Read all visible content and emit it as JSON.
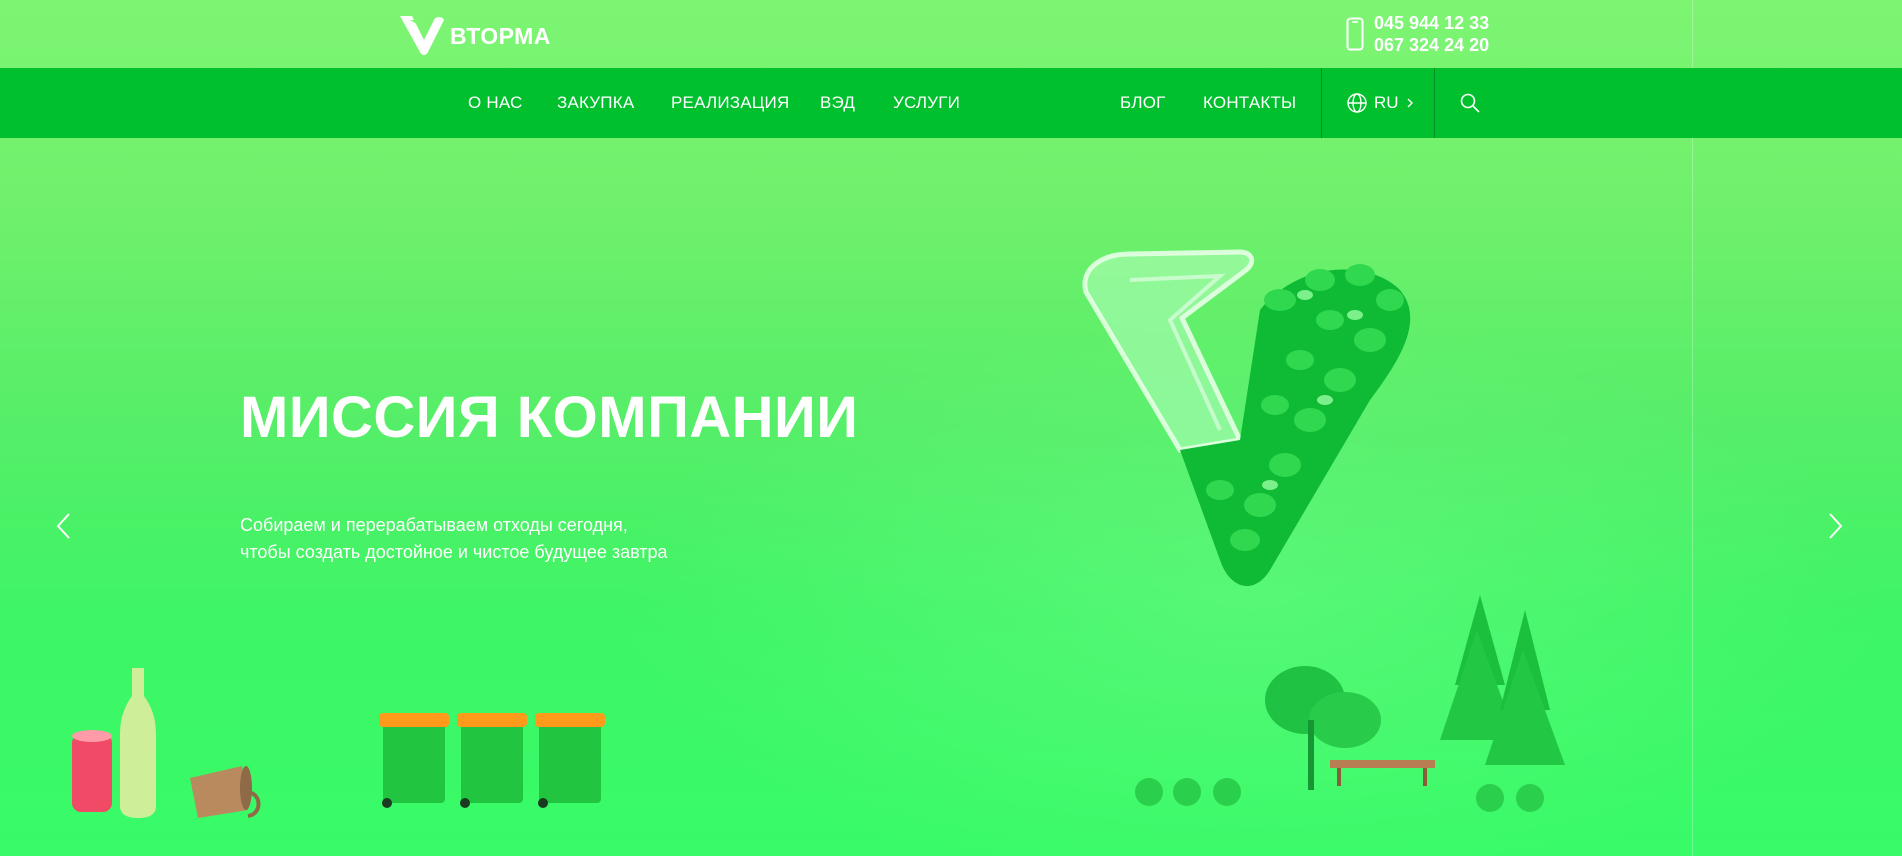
{
  "brand": {
    "name": "ВТОРМА",
    "logo_icon": "vtorma-v-logo-icon"
  },
  "contacts": {
    "phones": [
      "045 944 12 33",
      "067 324 24 20"
    ],
    "icon": "phone-icon"
  },
  "nav": {
    "left_items": [
      {
        "label": "О НАС"
      },
      {
        "label": "ЗАКУПКА"
      },
      {
        "label": "РЕАЛИЗАЦИЯ"
      },
      {
        "label": "ВЭД"
      },
      {
        "label": "УСЛУГИ"
      }
    ],
    "right_items": [
      {
        "label": "БЛОГ"
      },
      {
        "label": "КОНТАКТЫ"
      }
    ],
    "language": {
      "current": "RU",
      "icon": "globe-icon",
      "chevron": "chevron-right-icon"
    },
    "search_icon": "search-icon"
  },
  "hero": {
    "title": "МИССИЯ КОМПАНИИ",
    "subtitle_lines": [
      "Собираем и перерабатываем отходы сегодня,",
      "чтобы создать достойное и чистое будущее завтра"
    ],
    "prev_icon": "chevron-left-icon",
    "next_icon": "chevron-right-icon"
  },
  "colors": {
    "nav_bg": "#00c02d",
    "hero_top": "#7df573",
    "hero_bottom": "#38fb68",
    "text": "#ffffff"
  }
}
